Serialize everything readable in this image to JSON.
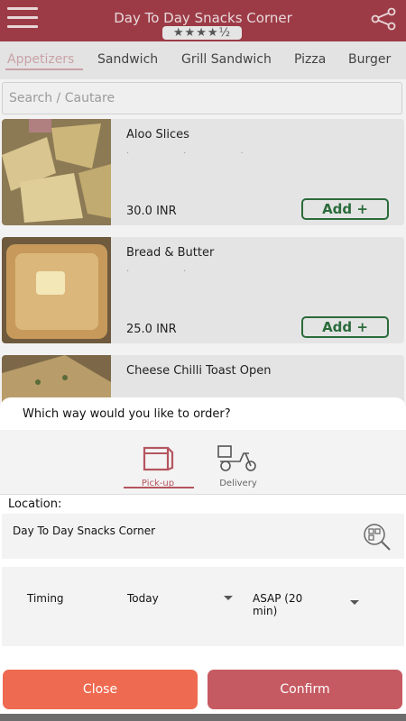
{
  "header": {
    "title": "Day To Day Snacks Corner",
    "rating_stars": "★★★★½",
    "menu_icon": "hamburger-menu-icon",
    "share_icon": "share-icon"
  },
  "tabs": [
    {
      "label": "Appetizers",
      "active": true
    },
    {
      "label": "Sandwich"
    },
    {
      "label": "Grill Sandwich"
    },
    {
      "label": "Pizza"
    },
    {
      "label": "Burger"
    }
  ],
  "search": {
    "placeholder": "Search / Cautare"
  },
  "items": [
    {
      "name": "Aloo Slices",
      "dots": "...",
      "price": "30.0 INR",
      "add_label": "Add +"
    },
    {
      "name": "Bread & Butter",
      "dots": "..",
      "price": "25.0 INR",
      "add_label": "Add +"
    },
    {
      "name": "Cheese Chilli Toast Open",
      "dots": "...",
      "price": "",
      "add_label": ""
    }
  ],
  "order_sheet": {
    "question": "Which way would you like to order?",
    "methods": [
      {
        "label": "Pick-up",
        "icon": "shopping-bag-icon",
        "selected": true
      },
      {
        "label": "Delivery",
        "icon": "scooter-icon",
        "selected": false
      }
    ],
    "location_label": "Location:",
    "location_name": "Day To Day Snacks Corner",
    "location_icon": "map-search-icon",
    "timing_label": "Timing",
    "day_value": "Today",
    "time_value": "ASAP (20 min)",
    "close_label": "Close",
    "confirm_label": "Confirm"
  },
  "colors": {
    "header": "#9c3b46",
    "accent": "#b5555f",
    "close_button": "#ee6a50",
    "confirm_button": "#c65a62",
    "add_button": "#2b6b3b"
  }
}
